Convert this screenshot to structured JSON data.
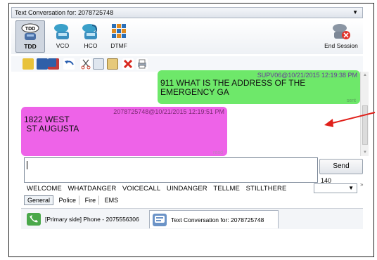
{
  "window": {
    "title": "Text Conversation for: 2078725748"
  },
  "toolbar": {
    "buttons": [
      {
        "label": "TDD",
        "badge": "TDD"
      },
      {
        "label": "VCO"
      },
      {
        "label": "HCO"
      },
      {
        "label": "DTMF"
      }
    ],
    "end_session_label": "End Session"
  },
  "conversation": {
    "outgoing": {
      "meta": "SUPV06@10/21/2015 12:19:38 PM",
      "text_line1": "911 WHAT IS THE ADDRESS OF THE",
      "text_line2": "EMERGENCY GA",
      "status": "sent"
    },
    "incoming": {
      "meta": "2078725748@10/21/2015 12:19:51 PM",
      "text_line1": "1822 WEST",
      "text_line2": " ST AUGUSTA",
      "status": "read"
    }
  },
  "compose": {
    "value": "",
    "send_label": "Send",
    "char_count": "140"
  },
  "quick_messages": [
    "WELCOME",
    "WHATDANGER",
    "VOICECALL",
    "UINDANGER",
    "TELLME",
    "STILLTHERE"
  ],
  "subtabs": [
    "General",
    "Police",
    "Fire",
    "EMS"
  ],
  "bottom_tabs": [
    {
      "label": "[Primary side] Phone - 2075556306"
    },
    {
      "label": "Text Conversation for: 2078725748"
    }
  ],
  "colors": {
    "outgoing_bubble": "#6ee86a",
    "incoming_bubble": "#ee63e8",
    "arrow": "#e0201a"
  }
}
